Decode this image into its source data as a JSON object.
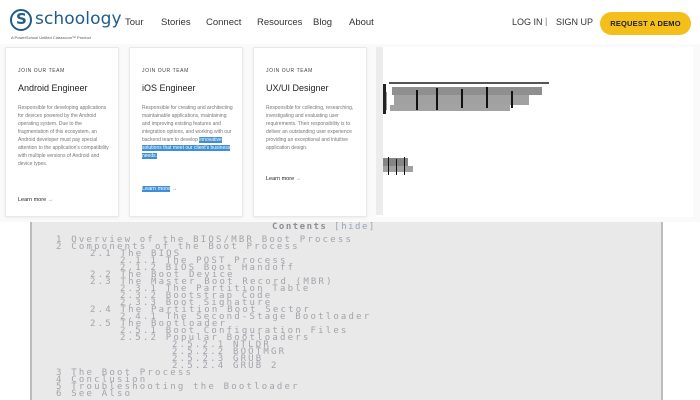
{
  "header": {
    "brand": "schoology",
    "brand_sub": "A PowerSchool Unified Classroom™ Product",
    "nav": [
      "Tour",
      "Stories",
      "Connect",
      "Resources",
      "Blog",
      "About"
    ],
    "login": "LOG IN",
    "separator": "|",
    "signup": "SIGN UP",
    "demo": "REQUEST A DEMO"
  },
  "cards": [
    {
      "tag": "JOIN OUR TEAM",
      "title": "Android Engineer",
      "desc": "Responsible for developing applications for devices powered by the Android operating system. Due to the fragmentation of this ecosystem, an Android developer must pay special attention to the application's compatibility with multiple versions of Android and device types.",
      "link": "Learn more"
    },
    {
      "tag": "JOIN OUR TEAM",
      "title": "iOS Engineer",
      "desc": "Responsible for creating and architecting maintainable applications, maintaining and improving existing features and integration options, and working with our backend team to develop",
      "desc_hl": "innovative solutions that meet our client's business needs.",
      "link": "Learn more"
    },
    {
      "tag": "JOIN OUR TEAM",
      "title": "UX/UI Designer",
      "desc": "Responsible for collecting, researching, investigating and evaluating user requirements. Their responsibility is to deliver an outstanding user experience providing an exceptional and intuitive application design.",
      "link": "Learn more"
    }
  ],
  "contents": {
    "title": "Contents",
    "hide": "[hide]",
    "lines": [
      "1  Overview of the BIOS/MBR Boot Process",
      "2  Components of the Boot Process",
      "2.1  The BIOS",
      "2.1.1  The POST Process",
      "2.1.2  BIOS Boot Handoff",
      "2.2  The Boot Device",
      "2.3  The Master Boot Record (MBR)",
      "2.3.1  The Partition Table",
      "2.3.2  Bootstrap Code",
      "2.3.3  Boot Signature",
      "2.4  The Partition Boot Sector",
      "2.4.1  The Second-Stage Bootloader",
      "2.5  The Bootloader",
      "2.5.1  Boot Configuration Files",
      "2.5.2  Popular Bootloaders",
      "2.5.2.1  NTLDR",
      "2.5.2.2  BOOTMGR",
      "2.5.2.3  GRUB",
      "2.5.2.4  GRUB 2",
      "3  The Boot Process",
      "4  Conclusion",
      "5  Troubleshooting the Bootloader",
      "6  See Also"
    ]
  },
  "colors": {
    "brand": "#1e5c8c",
    "demo_button": "#f5bf1b",
    "highlight": "#3d8fd6"
  }
}
